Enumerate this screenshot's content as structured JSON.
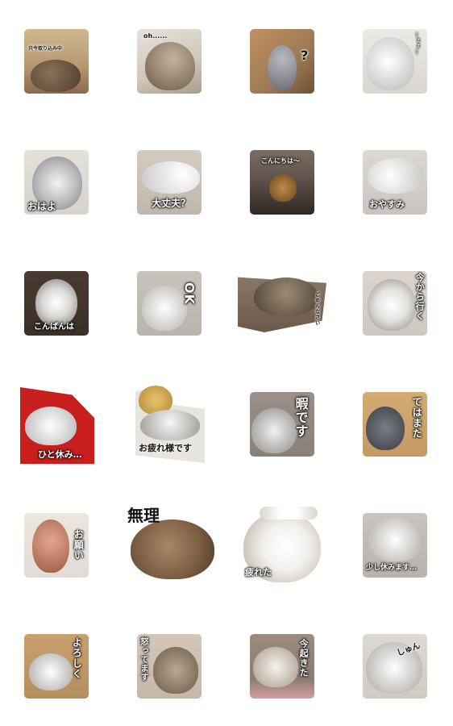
{
  "stickers": [
    {
      "caption": "只今取り込み中",
      "bg": "#b89a72",
      "cat": "#6e5a44"
    },
    {
      "caption": "oh......",
      "bg": "#cfc6b8",
      "cat": "#8a7a66"
    },
    {
      "caption": "?",
      "bg": "#9b7a55",
      "cat": "#8e8e96"
    },
    {
      "caption": "…ｚｚ…",
      "bg": "#d9d6d2",
      "cat": "#efefef"
    },
    {
      "caption": "おはよ",
      "bg": "#d6d2cc",
      "cat": "#b9b9bb"
    },
    {
      "caption": "大丈夫？",
      "bg": "#bfb7ac",
      "cat": "#f2f2f2"
    },
    {
      "caption": "こんにちは～",
      "bg": "#5b5048",
      "cat": "#a87a3e"
    },
    {
      "caption": "おやすみ",
      "bg": "#c9c4bf",
      "cat": "#eeeeee"
    },
    {
      "caption": "こんばんは",
      "bg": "#3b2f28",
      "cat": "#d8d8d8"
    },
    {
      "caption": "OK",
      "bg": "#b8b3ac",
      "cat": "#efefef"
    },
    {
      "caption": "ごめんなさい",
      "bg": "#6b5a4a",
      "cat": "#7a6a58"
    },
    {
      "caption": "今から行く",
      "bg": "#cfc8c0",
      "cat": "#e4e2df"
    },
    {
      "caption": "ひと休み…",
      "bg": "#c81e1e",
      "cat": "#f4f4f4"
    },
    {
      "caption": "お疲れ様です",
      "bg": "#e7e3df",
      "cat": "#d9b45a"
    },
    {
      "caption": "暇です",
      "bg": "#8a8078",
      "cat": "#d4d2d0"
    },
    {
      "caption": "てはまた",
      "bg": "#c49a62",
      "cat": "#5a5d66"
    },
    {
      "caption": "お願い",
      "bg": "#e2dcd4",
      "cat": "#c98f73"
    },
    {
      "caption": "無理",
      "bg": "#ffffff",
      "cat": "#7d5f43"
    },
    {
      "caption": "疲れた",
      "bg": "#ffffff",
      "cat": "#f3f1ee"
    },
    {
      "caption": "少し休みます…",
      "bg": "#b9b3ad",
      "cat": "#efedeb"
    },
    {
      "caption": "よろしく",
      "bg": "#b58e5e",
      "cat": "#f0f0f0"
    },
    {
      "caption": "怒ってます",
      "bg": "#c7b7a9",
      "cat": "#8c7a66"
    },
    {
      "caption": "今起きた",
      "bg": "#8c7b6f",
      "cat": "#e9e2da"
    },
    {
      "caption": "しゅん",
      "bg": "#cfcac4",
      "cat": "#f4f4f4"
    }
  ]
}
